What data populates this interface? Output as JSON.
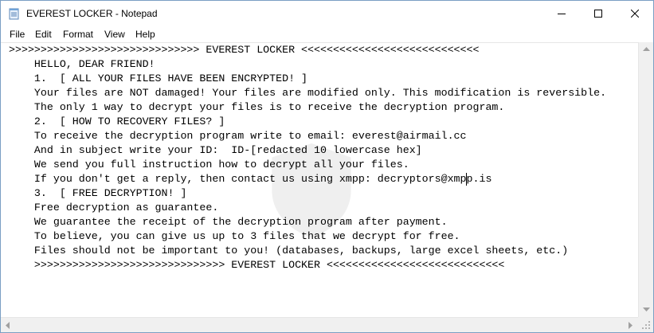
{
  "window": {
    "title": "EVEREST LOCKER - Notepad",
    "icon": "notepad-icon",
    "controls": [
      "minimize-icon",
      "maximize-icon",
      "close-icon"
    ]
  },
  "menu": {
    "items": [
      "File",
      "Edit",
      "Format",
      "View",
      "Help"
    ]
  },
  "document": {
    "lines": [
      ">>>>>>>>>>>>>>>>>>>>>>>>>>>>>> EVEREST LOCKER <<<<<<<<<<<<<<<<<<<<<<<<<<<<",
      "    HELLO, DEAR FRIEND!",
      "    1.  [ ALL YOUR FILES HAVE BEEN ENCRYPTED! ]",
      "    Your files are NOT damaged! Your files are modified only. This modification is reversible.",
      "    The only 1 way to decrypt your files is to receive the decryption program.",
      "    2.  [ HOW TO RECOVERY FILES? ]",
      "    To receive the decryption program write to email: everest@airmail.cc",
      "    And in subject write your ID:  ID-[redacted 10 lowercase hex]",
      "    We send you full instruction how to decrypt all your files.",
      "    If you don't get a reply, then contact us using xmpp: decryptors@xmpp.is",
      "    3.  [ FREE DECRYPTION! ]",
      "    Free decryption as guarantee.",
      "    We guarantee the receipt of the decryption program after payment.",
      "    To believe, you can give us up to 3 files that we decrypt for free.",
      "    Files should not be important to you! (databases, backups, large excel sheets, etc.)",
      "    >>>>>>>>>>>>>>>>>>>>>>>>>>>>>> EVEREST LOCKER <<<<<<<<<<<<<<<<<<<<<<<<<<<<"
    ]
  },
  "colors": {
    "window_border": "#7a9fc4",
    "scrollbar_bg": "#f0f0f0",
    "text": "#000000"
  }
}
